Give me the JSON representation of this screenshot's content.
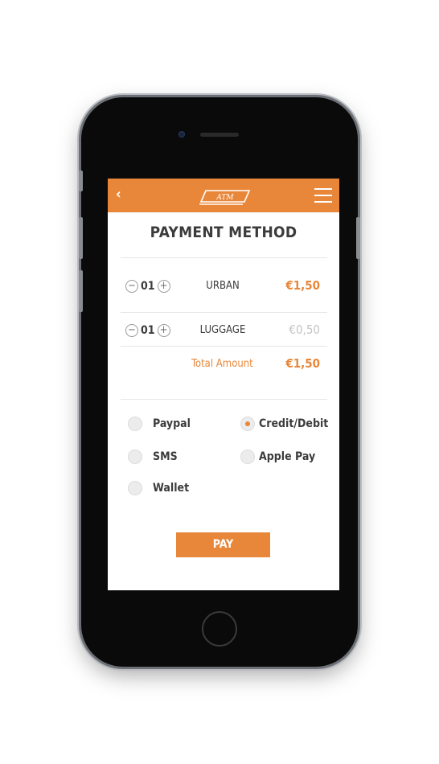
{
  "header": {
    "back_icon": "chevron-left-icon",
    "logo_text": "ATM",
    "menu_icon": "hamburger-icon"
  },
  "page_title": "PAYMENT METHOD",
  "tickets": [
    {
      "quantity": "01",
      "name": "URBAN",
      "price": "€1,50",
      "price_color": "#e8873a"
    },
    {
      "quantity": "01",
      "name": "LUGGAGE",
      "price": "€0,50",
      "price_color": "#c4c4c4"
    }
  ],
  "total": {
    "label": "Total Amount",
    "value": "€1,50"
  },
  "payment_options": [
    {
      "label": "Paypal",
      "selected": false
    },
    {
      "label": "Credit/Debit",
      "selected": true
    },
    {
      "label": "SMS",
      "selected": false
    },
    {
      "label": "Apple Pay",
      "selected": false
    },
    {
      "label": "Wallet",
      "selected": false
    }
  ],
  "pay_button": "PAY",
  "colors": {
    "accent": "#e8873a",
    "text": "#3b3b3b",
    "muted": "#c4c4c4"
  }
}
